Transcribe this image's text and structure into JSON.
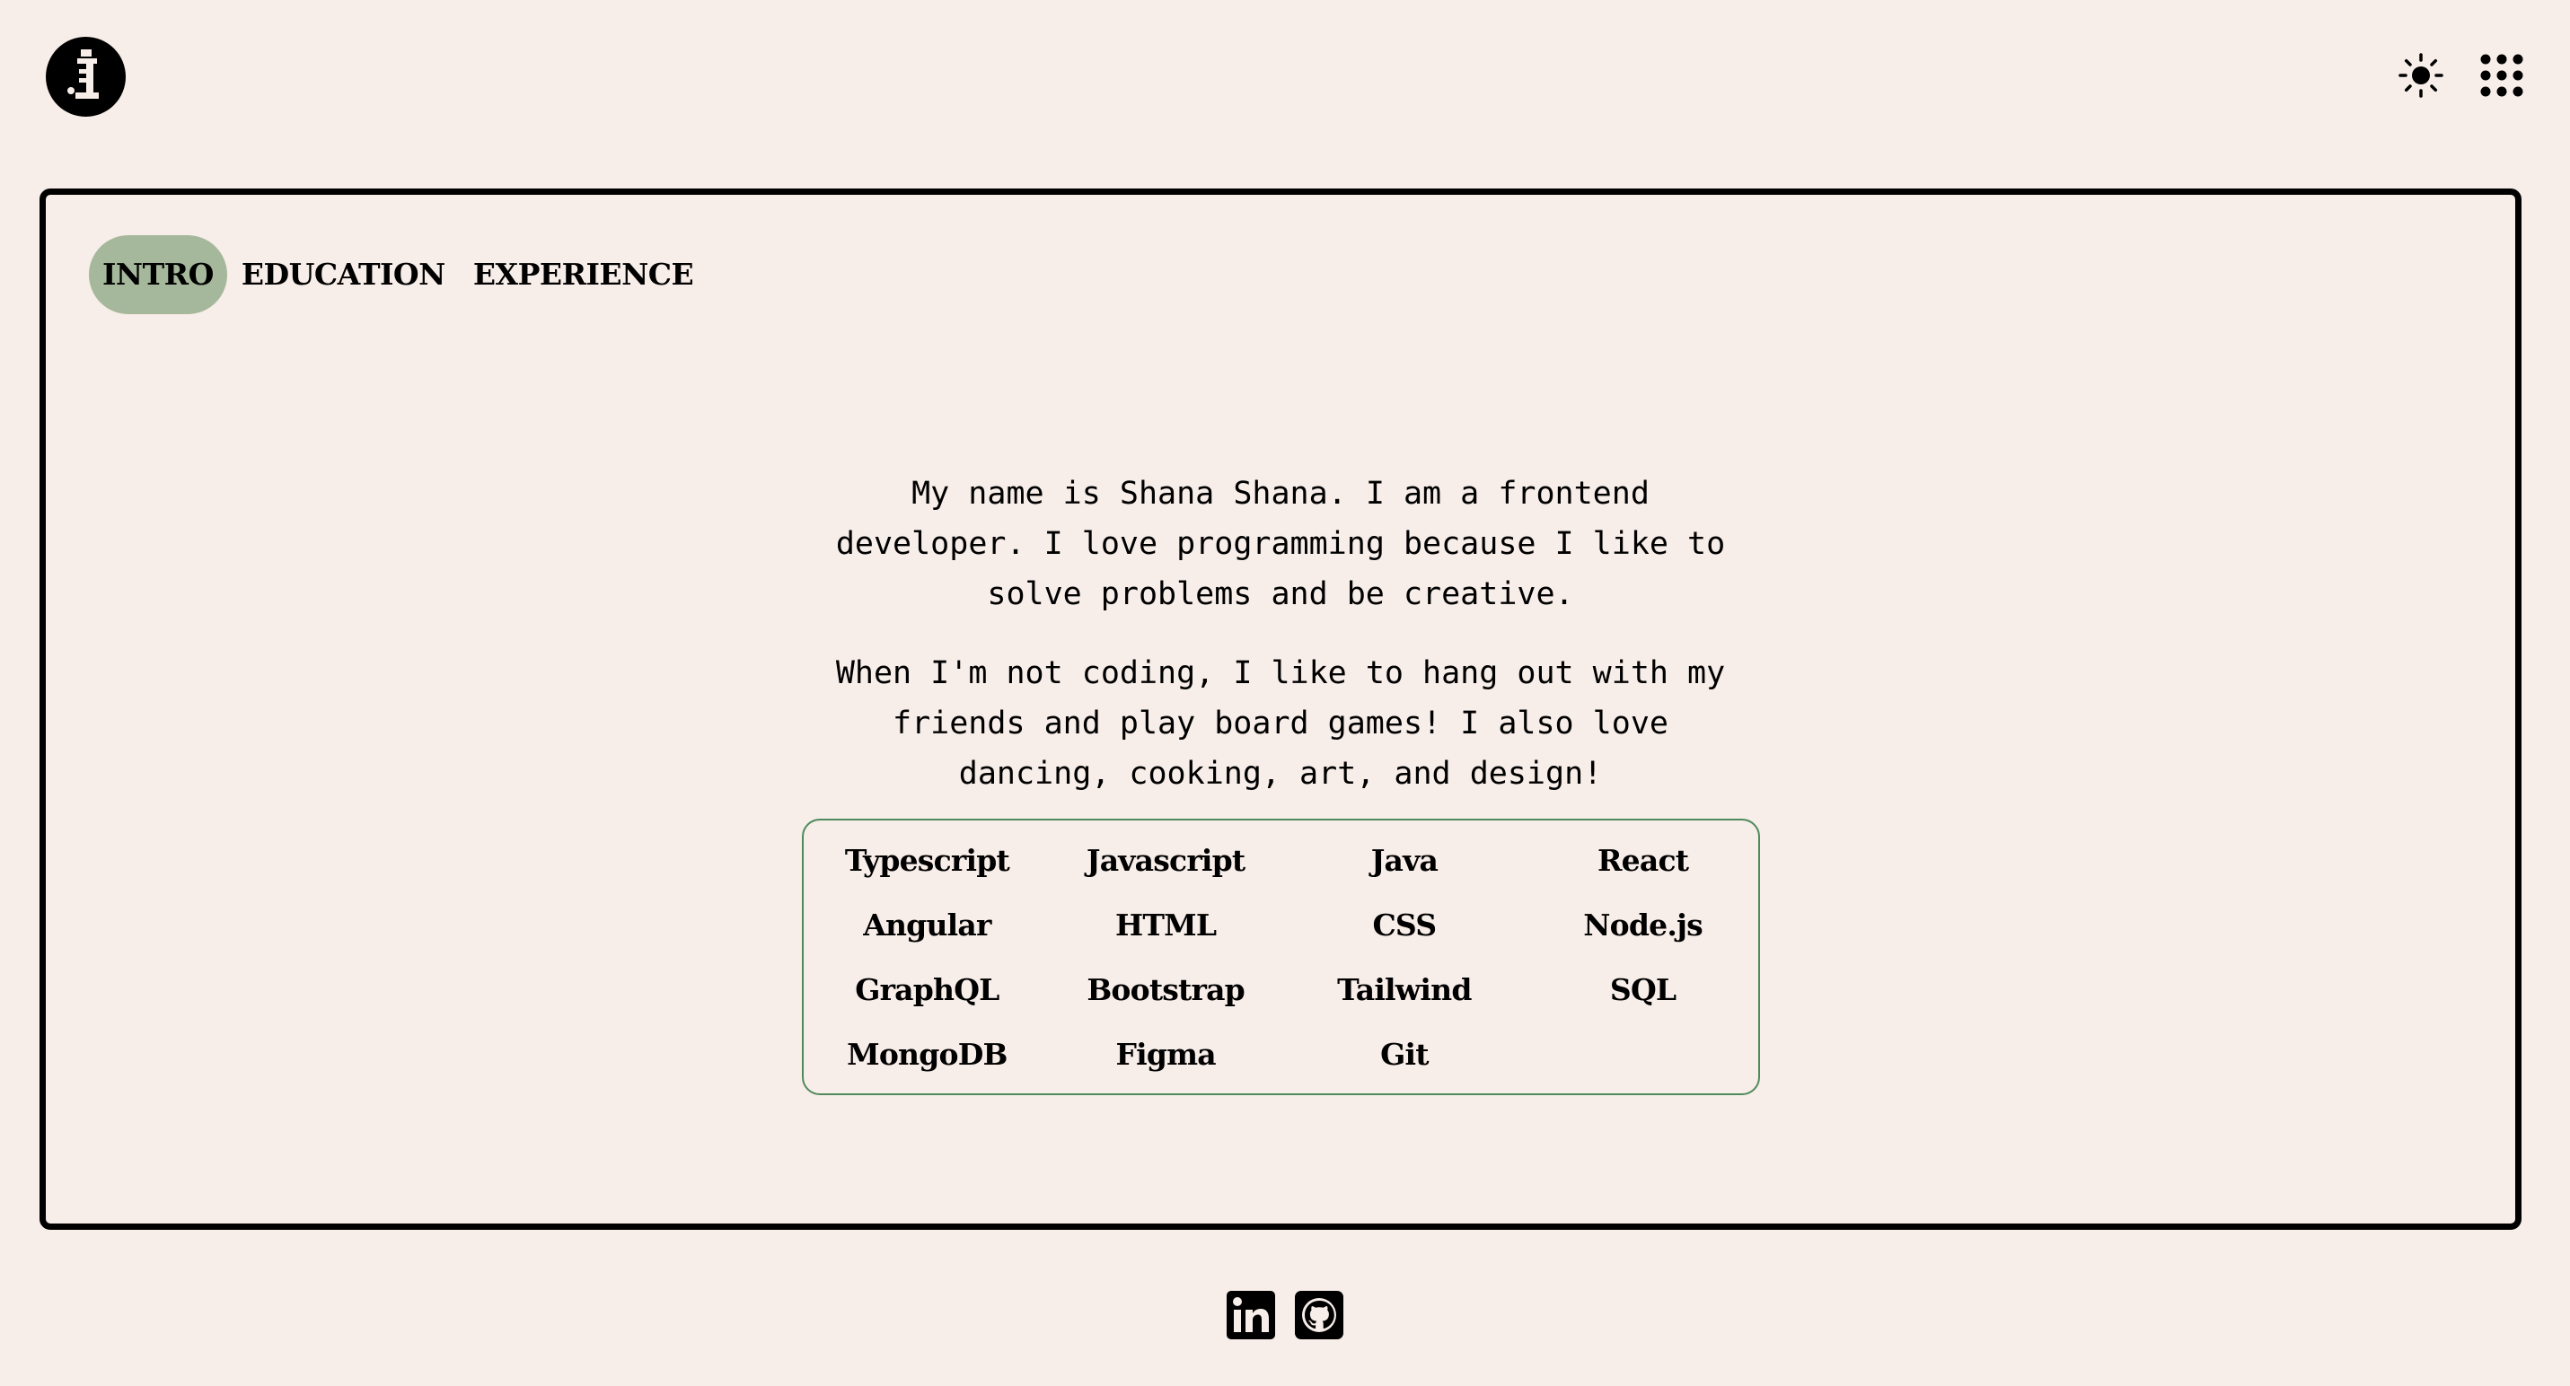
{
  "header": {
    "logo_icon": "logo-icon",
    "theme_toggle_icon": "sun-icon",
    "apps_menu_icon": "grid-dots-icon"
  },
  "tabs": [
    {
      "label": "INTRO",
      "active": true
    },
    {
      "label": "EDUCATION",
      "active": false
    },
    {
      "label": "EXPERIENCE",
      "active": false
    }
  ],
  "intro": {
    "paragraph1": "My name is Shana Shana. I am a frontend developer. I love programming because I like to solve problems and be creative.",
    "paragraph2": "When I'm not coding, I like to hang out with my friends and play board games! I also love dancing, cooking, art, and design!"
  },
  "skills": [
    "Typescript",
    "Javascript",
    "Java",
    "React",
    "Angular",
    "HTML",
    "CSS",
    "Node.js",
    "GraphQL",
    "Bootstrap",
    "Tailwind",
    "SQL",
    "MongoDB",
    "Figma",
    "Git"
  ],
  "footer": {
    "links": [
      {
        "icon": "linkedin-icon"
      },
      {
        "icon": "github-icon"
      }
    ]
  },
  "colors": {
    "background": "#f7ede9",
    "active_tab": "#a6b89b",
    "skills_border": "#4f8a5c",
    "text": "#000000"
  }
}
